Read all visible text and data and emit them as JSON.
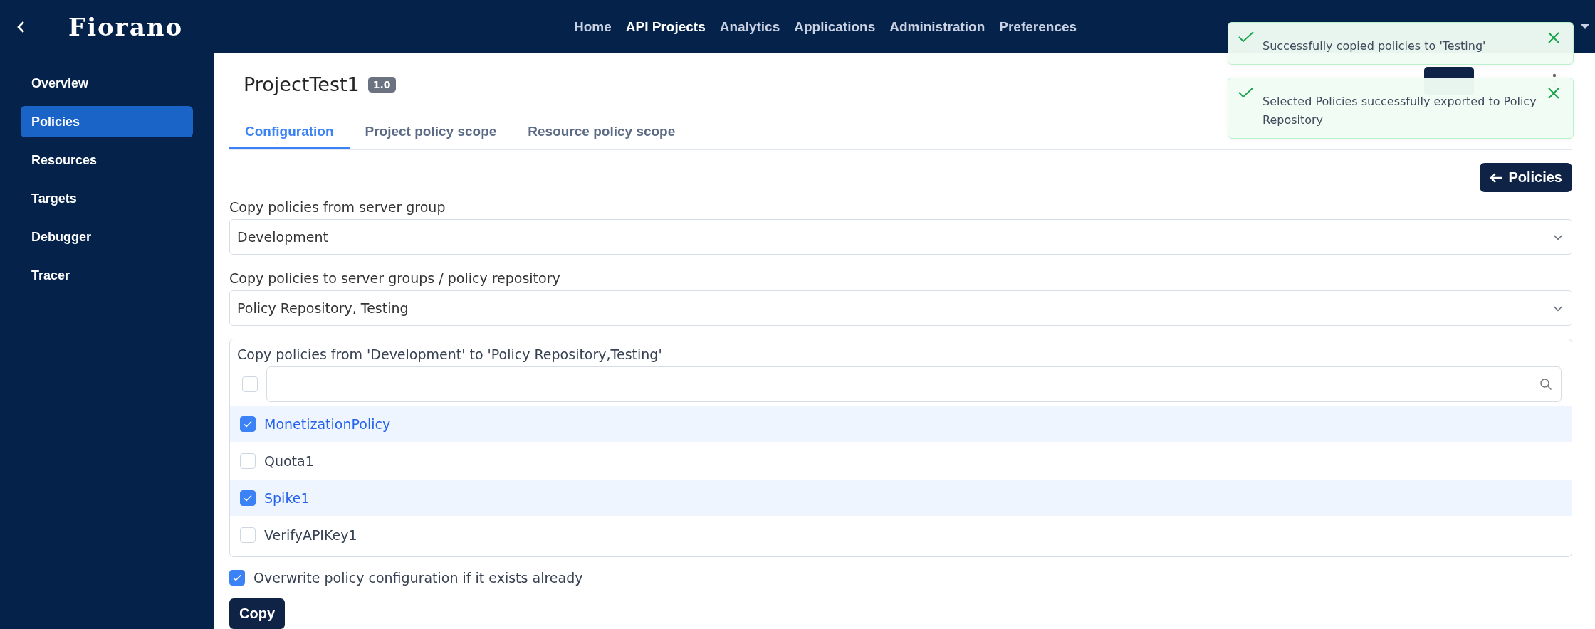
{
  "header": {
    "logo": "Fiorano",
    "nav": [
      {
        "label": "Home",
        "selected": false
      },
      {
        "label": "API Projects",
        "selected": true
      },
      {
        "label": "Analytics",
        "selected": false
      },
      {
        "label": "Applications",
        "selected": false
      },
      {
        "label": "Administration",
        "selected": false
      },
      {
        "label": "Preferences",
        "selected": false
      }
    ]
  },
  "sidebar": {
    "items": [
      {
        "label": "Overview",
        "selected": false
      },
      {
        "label": "Policies",
        "selected": true
      },
      {
        "label": "Resources",
        "selected": false
      },
      {
        "label": "Targets",
        "selected": false
      },
      {
        "label": "Debugger",
        "selected": false
      },
      {
        "label": "Tracer",
        "selected": false
      }
    ]
  },
  "project": {
    "title": "ProjectTest1",
    "version": "1.0"
  },
  "tabs": [
    {
      "label": "Configuration",
      "selected": true
    },
    {
      "label": "Project policy scope",
      "selected": false
    },
    {
      "label": "Resource policy scope",
      "selected": false
    }
  ],
  "back_button": "Policies",
  "source": {
    "label": "Copy policies from server group",
    "value": "Development"
  },
  "target": {
    "label": "Copy policies to server groups / policy repository",
    "value": "Policy Repository, Testing"
  },
  "policy_list": {
    "title": "Copy policies from 'Development' to 'Policy Repository,Testing'",
    "select_all": {
      "checked": false
    },
    "items": [
      {
        "name": "MonetizationPolicy",
        "checked": true
      },
      {
        "name": "Quota1",
        "checked": false
      },
      {
        "name": "Spike1",
        "checked": true
      },
      {
        "name": "VerifyAPIKey1",
        "checked": false
      }
    ]
  },
  "overwrite": {
    "label": "Overwrite policy configuration if it exists already",
    "checked": true
  },
  "copy_button": "Copy",
  "toasts": [
    {
      "message": "Successfully copied policies to 'Testing'"
    },
    {
      "message": "Selected Policies successfully exported to Policy Repository"
    }
  ]
}
